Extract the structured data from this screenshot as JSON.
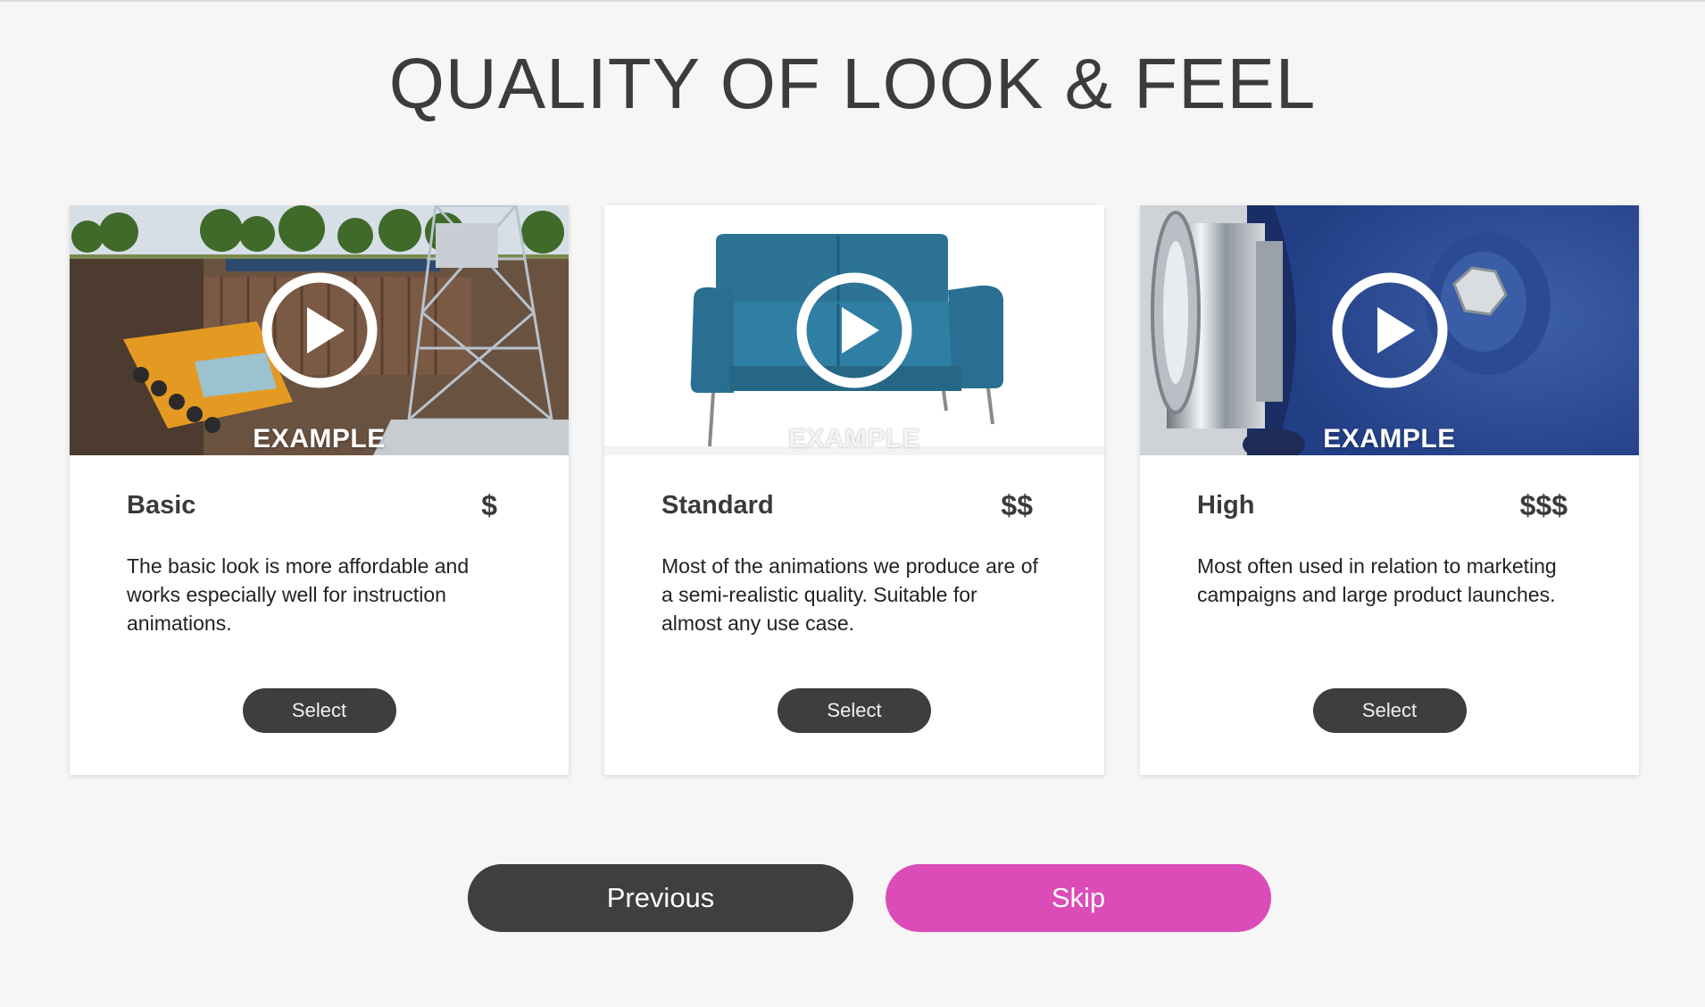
{
  "page": {
    "title": "QUALITY OF LOOK & FEEL"
  },
  "cards": [
    {
      "tier": "Basic",
      "price": "$",
      "example_label": "EXAMPLE",
      "description": "The basic look is more affordable and works especially well for instruction animations.",
      "select_label": "Select",
      "thumbnail": "construction-site-crane-tower-scene"
    },
    {
      "tier": "Standard",
      "price": "$$",
      "example_label": "EXAMPLE",
      "description": "Most of the animations we produce are of a semi-realistic quality. Suitable for almost any use case.",
      "select_label": "Select",
      "thumbnail": "blue-sofa-scene"
    },
    {
      "tier": "High",
      "price": "$$$",
      "example_label": "EXAMPLE",
      "description": "Most often used in relation to marketing campaigns and large product launches.",
      "select_label": "Select",
      "thumbnail": "metal-valve-closeup-scene"
    }
  ],
  "nav": {
    "previous_label": "Previous",
    "skip_label": "Skip"
  },
  "colors": {
    "accent": "#db4cb8",
    "dark_button": "#3f3f3f",
    "background": "#f6f6f6"
  },
  "icons": {
    "play": "play-circle-icon"
  }
}
